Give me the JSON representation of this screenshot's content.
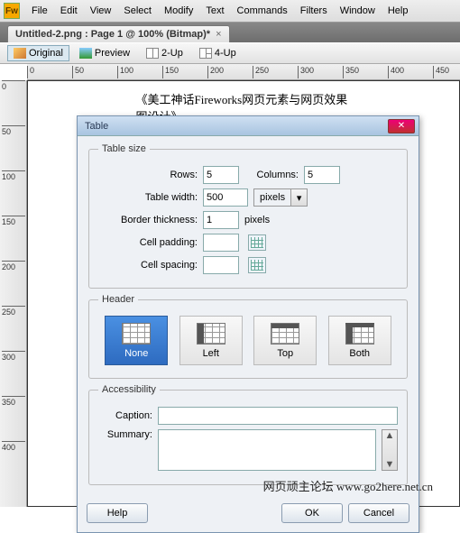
{
  "menu": [
    "File",
    "Edit",
    "View",
    "Select",
    "Modify",
    "Text",
    "Commands",
    "Filters",
    "Window",
    "Help"
  ],
  "app_icon": "Fw",
  "doc_tab": {
    "title": "Untitled-2.png : Page 1 @ 100% (Bitmap)*",
    "close": "×"
  },
  "view_modes": {
    "original": "Original",
    "preview": "Preview",
    "twoup": "2-Up",
    "fourup": "4-Up"
  },
  "ruler_h": [
    "0",
    "50",
    "100",
    "150",
    "200",
    "250",
    "300",
    "350",
    "400",
    "450"
  ],
  "ruler_v": [
    "0",
    "50",
    "100",
    "150",
    "200",
    "250",
    "300",
    "350",
    "400"
  ],
  "doc_heading": "《美工神话Fireworks网页元素与网页效果图设计》",
  "dialog": {
    "title": "Table",
    "groups": {
      "size": "Table size",
      "header": "Header",
      "access": "Accessibility"
    },
    "labels": {
      "rows": "Rows:",
      "columns": "Columns:",
      "width": "Table width:",
      "border": "Border thickness:",
      "cellpad": "Cell padding:",
      "cellspace": "Cell spacing:",
      "caption": "Caption:",
      "summary": "Summary:"
    },
    "values": {
      "rows": "5",
      "columns": "5",
      "width": "500",
      "border": "1",
      "cellpad": "",
      "cellspace": ""
    },
    "units": {
      "width": "pixels",
      "border": "pixels"
    },
    "header_opts": {
      "none": "None",
      "left": "Left",
      "top": "Top",
      "both": "Both"
    },
    "buttons": {
      "help": "Help",
      "ok": "OK",
      "cancel": "Cancel"
    }
  },
  "footer": "网页顽主论坛  www.go2here.net.cn"
}
